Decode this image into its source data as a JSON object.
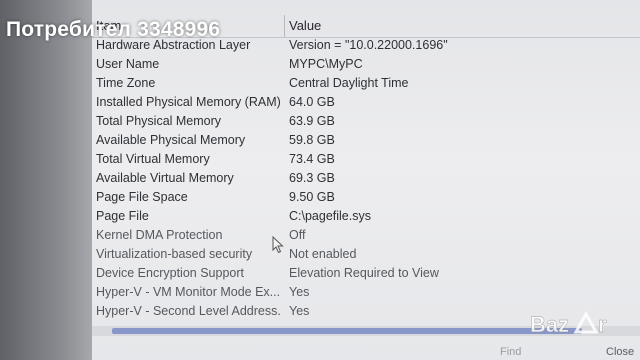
{
  "watermark": "Потребител 3348996",
  "columns": {
    "item": "Item",
    "value": "Value"
  },
  "rows": [
    {
      "item": "Hardware Abstraction Layer",
      "value": "Version = \"10.0.22000.1696\""
    },
    {
      "item": "User Name",
      "value": "MYPC\\MyPC"
    },
    {
      "item": "Time Zone",
      "value": "Central Daylight Time"
    },
    {
      "item": "Installed Physical Memory (RAM)",
      "value": "64.0 GB"
    },
    {
      "item": "Total Physical Memory",
      "value": "63.9 GB"
    },
    {
      "item": "Available Physical Memory",
      "value": "59.8 GB"
    },
    {
      "item": "Total Virtual Memory",
      "value": "73.4 GB"
    },
    {
      "item": "Available Virtual Memory",
      "value": "69.3 GB"
    },
    {
      "item": "Page File Space",
      "value": "9.50 GB"
    },
    {
      "item": "Page File",
      "value": "C:\\pagefile.sys"
    },
    {
      "item": "Kernel DMA Protection",
      "value": "Off"
    },
    {
      "item": "Virtualization-based security",
      "value": "Not enabled"
    },
    {
      "item": "Device Encryption Support",
      "value": "Elevation Required to View"
    },
    {
      "item": "Hyper-V - VM Monitor Mode Ex...",
      "value": "Yes"
    },
    {
      "item": "Hyper-V - Second Level Address...",
      "value": "Yes"
    }
  ],
  "footer": {
    "find": "Find",
    "close": "Close"
  },
  "logo": "Bazar",
  "colors": {
    "scroll_thumb": "#8996c9",
    "window_bg": "#ececee"
  }
}
